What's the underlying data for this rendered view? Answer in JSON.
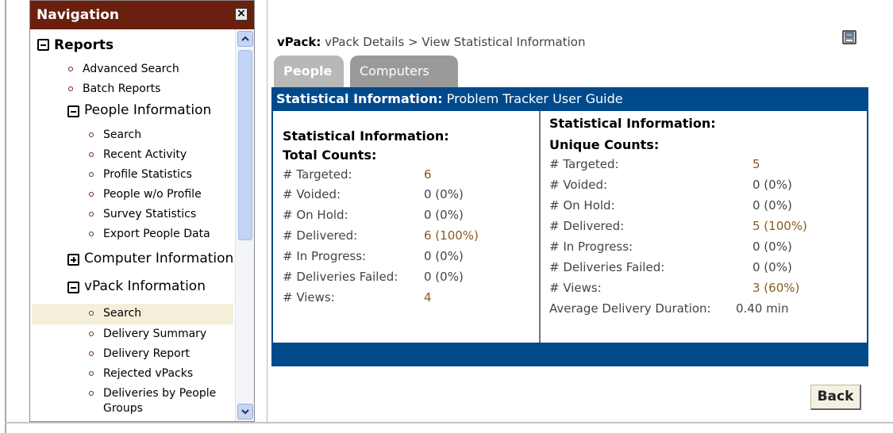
{
  "nav": {
    "title": "Navigation",
    "close_glyph": "☒",
    "items": [
      {
        "label": "Reports",
        "icon": "collapse-box-icon"
      },
      {
        "label": "Advanced Search",
        "icon": "bullet-icon"
      },
      {
        "label": "Batch Reports",
        "icon": "bullet-icon"
      },
      {
        "label": "People Information",
        "icon": "collapse-box-icon"
      },
      {
        "label": "Search",
        "icon": "bullet-icon"
      },
      {
        "label": "Recent Activity",
        "icon": "bullet-icon"
      },
      {
        "label": "Profile Statistics",
        "icon": "bullet-icon"
      },
      {
        "label": "People w/o Profile",
        "icon": "bullet-icon"
      },
      {
        "label": "Survey Statistics",
        "icon": "bullet-icon"
      },
      {
        "label": "Export People Data",
        "icon": "bullet-icon"
      },
      {
        "label": "Computer Information",
        "icon": "expand-box-icon"
      },
      {
        "label": "vPack Information",
        "icon": "collapse-box-icon"
      },
      {
        "label": "Search",
        "icon": "bullet-icon",
        "selected": true
      },
      {
        "label": "Delivery Summary",
        "icon": "bullet-icon"
      },
      {
        "label": "Delivery Report",
        "icon": "bullet-icon"
      },
      {
        "label": "Rejected vPacks",
        "icon": "bullet-icon"
      },
      {
        "label": "Deliveries by People",
        "icon": "bullet-icon"
      },
      {
        "label": "Groups",
        "icon": ""
      }
    ]
  },
  "breadcrumb": {
    "prefix": "vPack:",
    "path": "vPack Details > View Statistical Information"
  },
  "tabs": [
    {
      "label": "People",
      "active": true
    },
    {
      "label": "Computers",
      "active": false
    }
  ],
  "panel": {
    "title_bold": "Statistical Information:",
    "title_rest": "Problem Tracker User Guide",
    "left": {
      "heading1": "Statistical Information:",
      "heading2": "Total Counts:",
      "rows": [
        {
          "label": "# Targeted:",
          "value": "6"
        },
        {
          "label": "# Voided:",
          "value": "0 (0%)"
        },
        {
          "label": "# On Hold:",
          "value": "0 (0%)"
        },
        {
          "label": "# Delivered:",
          "value": "6 (100%)"
        },
        {
          "label": "# In Progress:",
          "value": "0 (0%)"
        },
        {
          "label": "# Deliveries Failed:",
          "value": "0 (0%)"
        },
        {
          "label": "# Views:",
          "value": "4"
        }
      ]
    },
    "right": {
      "heading1": "Statistical Information:",
      "heading2": "Unique Counts:",
      "rows": [
        {
          "label": "# Targeted:",
          "value": "5"
        },
        {
          "label": "# Voided:",
          "value": "0 (0%)"
        },
        {
          "label": "# On Hold:",
          "value": "0 (0%)"
        },
        {
          "label": "# Delivered:",
          "value": "5 (100%)"
        },
        {
          "label": "# In Progress:",
          "value": "0 (0%)"
        },
        {
          "label": "# Deliveries Failed:",
          "value": "0 (0%)"
        },
        {
          "label": "# Views:",
          "value": "3 (60%)"
        }
      ],
      "avg_label": "Average Delivery Duration:",
      "avg_value": "0.40 min"
    }
  },
  "back_label": "Back",
  "colors": {
    "nav_header": "#6a1f0f",
    "panel_blue": "#004a8c",
    "selected_bg": "#f4efd9",
    "value_accent": "#8a5a20"
  }
}
